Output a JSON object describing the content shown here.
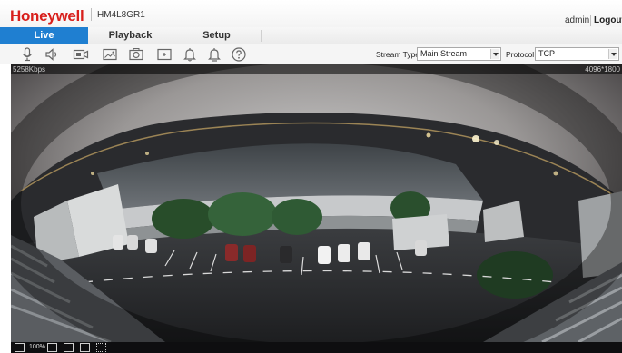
{
  "header": {
    "brand": "Honeywell",
    "model": "HM4L8GR1",
    "user": "admin",
    "logout_label": "Logout"
  },
  "nav": {
    "tabs": [
      {
        "label": "Live",
        "active": true
      },
      {
        "label": "Playback",
        "active": false
      },
      {
        "label": "Setup",
        "active": false
      }
    ]
  },
  "toolbar": {
    "icons": [
      "microphone-icon",
      "speaker-icon",
      "record-icon",
      "snapshot-icon",
      "capture-icon",
      "zoom-icon",
      "alarm-bell-icon",
      "alarm-out-bell-icon",
      "help-icon"
    ],
    "stream_type_label": "Stream Type",
    "stream_type_value": "Main Stream",
    "protocol_label": "Protocol",
    "protocol_value": "TCP"
  },
  "video": {
    "bitrate": "5258Kbps",
    "resolution": "4096*1800"
  },
  "bottombar": {
    "zoom_label": "100%",
    "icons": [
      "fit-screen-icon",
      "actual-size-icon",
      "full-screen-icon",
      "aspect-ratio-icon",
      "grid-icon",
      "settings-icon"
    ]
  },
  "colors": {
    "brand_red": "#d8201c",
    "active_tab": "#1f7fd1"
  }
}
